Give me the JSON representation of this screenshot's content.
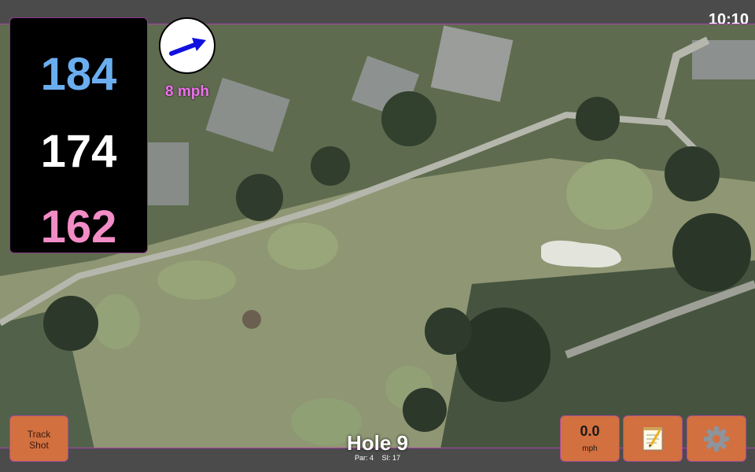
{
  "status_bar": {
    "time": "10:10"
  },
  "distances": {
    "back": "184",
    "middle": "174",
    "front": "162"
  },
  "wind": {
    "speed": "8 mph",
    "icon": "wind-arrow-icon",
    "arrow_color": "#1010e0"
  },
  "track_shot": {
    "label_line1": "Track",
    "label_line2": "Shot"
  },
  "speed": {
    "value": "0.0",
    "unit": "mph"
  },
  "notes": {
    "icon": "notepad-icon"
  },
  "settings": {
    "icon": "gear-icon"
  },
  "hole": {
    "title": "Hole 9",
    "par": "Par: 4",
    "si": "SI: 17"
  },
  "colors": {
    "accent": "#d2703f",
    "back_distance": "#6aaef0",
    "front_distance": "#f28cc6",
    "wind_text": "#f070f0"
  }
}
